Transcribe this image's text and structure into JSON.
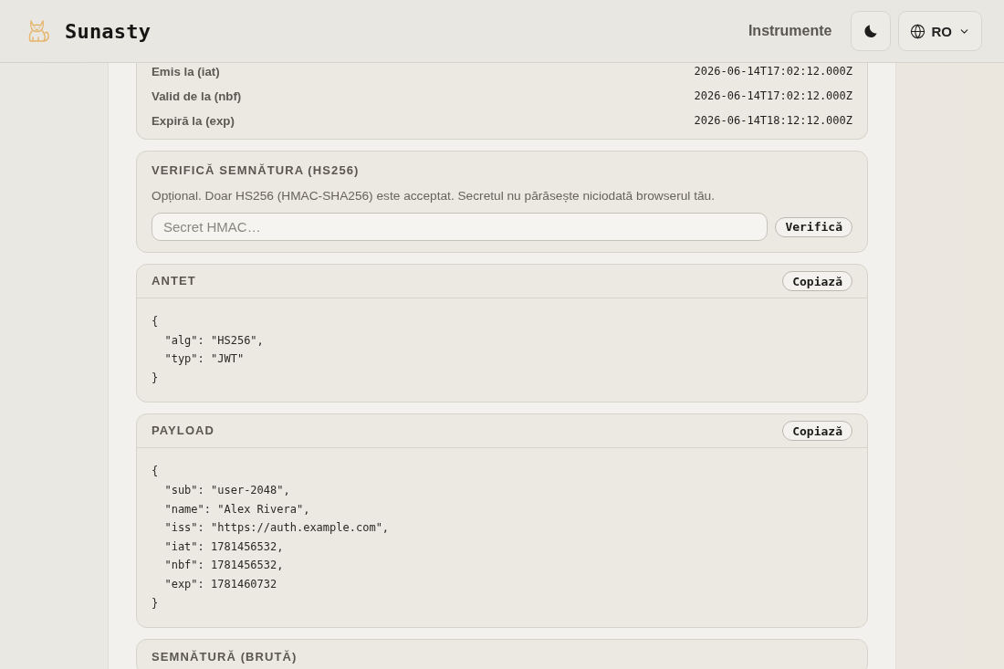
{
  "header": {
    "brand": "Sunasty",
    "nav_link": "Instrumente",
    "language": "RO"
  },
  "claims": [
    {
      "label": "Emis la (iat)",
      "value": "2026-06-14T17:02:12.000Z"
    },
    {
      "label": "Valid de la (nbf)",
      "value": "2026-06-14T17:02:12.000Z"
    },
    {
      "label": "Expiră la (exp)",
      "value": "2026-06-14T18:12:12.000Z"
    }
  ],
  "verify": {
    "title": "VERIFICĂ SEMNĂTURA (HS256)",
    "description": "Opțional. Doar HS256 (HMAC-SHA256) este acceptat. Secretul nu părăsește niciodată browserul tău.",
    "secret_field": {
      "placeholder": "Secret HMAC…"
    },
    "button": "Verifică"
  },
  "sections": [
    {
      "title": "ANTET",
      "copy_button": "Copiază",
      "code_lines": [
        "{",
        "  \"alg\": \"HS256\",",
        "  \"typ\": \"JWT\"",
        "}"
      ]
    },
    {
      "title": "PAYLOAD",
      "copy_button": "Copiază",
      "code_lines": [
        "{",
        "  \"sub\": \"user-2048\",",
        "  \"name\": \"Alex Rivera\",",
        "  \"iss\": \"https://auth.example.com\",",
        "  \"iat\": 1781456532,",
        "  \"nbf\": 1781456532,",
        "  \"exp\": 1781460732",
        "}"
      ]
    },
    {
      "title": "SEMNĂTURĂ (BRUTĂ)"
    }
  ]
}
